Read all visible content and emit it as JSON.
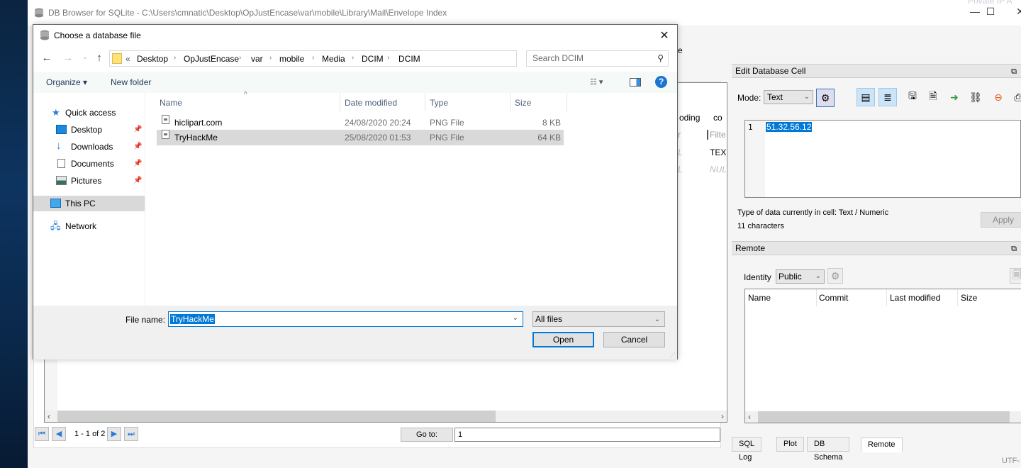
{
  "app": {
    "title": "DB Browser for SQLite - C:\\Users\\cmnatic\\Desktop\\OpJustEncase\\var\\mobile\\Library\\Mail\\Envelope Index",
    "window_controls": {
      "minimize": "—",
      "maximize": "☐",
      "close": "✕"
    },
    "background_snippet": "Private IP A",
    "toolbar_partial_text": "e",
    "table_peek": {
      "header_1": "oding",
      "header_2": "co",
      "filter_1": "r",
      "filter_2": "Filte",
      "row1_c1": "L",
      "row1_c2": "TEX",
      "row2_c1": "L",
      "row2_c2": "NUL"
    },
    "pager": {
      "first": "⏮",
      "prev": "◀",
      "label": "1 - 1 of 2",
      "next": "▶",
      "last": "⏭",
      "goto_label": "Go to:",
      "goto_value": "1"
    },
    "edit_cell": {
      "title": "Edit Database Cell",
      "mode_label": "Mode:",
      "mode_value": "Text",
      "line_number": "1",
      "value": "51.32.56.12",
      "type_text": "Type of data currently in cell: Text / Numeric",
      "chars_text": "11 characters",
      "apply_label": "Apply"
    },
    "remote": {
      "title": "Remote",
      "identity_label": "Identity",
      "identity_value": "Public",
      "columns": [
        "Name",
        "Commit",
        "Last modified",
        "Size"
      ]
    },
    "bottom_tabs": [
      {
        "label": "SQL Log",
        "active": false
      },
      {
        "label": "Plot",
        "active": false
      },
      {
        "label": "DB Schema",
        "active": false
      },
      {
        "label": "Remote",
        "active": true
      }
    ],
    "status_encoding": "UTF-"
  },
  "dialog": {
    "title": "Choose a database file",
    "close": "✕",
    "nav": {
      "back": "←",
      "forward": "→",
      "recent": "⌄",
      "up": "↑"
    },
    "breadcrumb_overflow": "«",
    "breadcrumb": [
      "Desktop",
      "OpJustEncase",
      "var",
      "mobile",
      "Media",
      "DCIM",
      "DCIM"
    ],
    "search_placeholder": "Search DCIM",
    "organize_label": "Organize ▾",
    "new_folder_label": "New folder",
    "nav_pane": [
      {
        "label": "Quick access",
        "icon": "star-icon",
        "pinned": false,
        "selected": false
      },
      {
        "label": "Desktop",
        "icon": "desktop-icon",
        "pinned": true,
        "selected": false
      },
      {
        "label": "Downloads",
        "icon": "download-icon",
        "pinned": true,
        "selected": false
      },
      {
        "label": "Documents",
        "icon": "documents-icon",
        "pinned": true,
        "selected": false
      },
      {
        "label": "Pictures",
        "icon": "pictures-icon",
        "pinned": true,
        "selected": false
      },
      {
        "label": "This PC",
        "icon": "computer-icon",
        "pinned": false,
        "selected": true
      },
      {
        "label": "Network",
        "icon": "network-icon",
        "pinned": false,
        "selected": false
      }
    ],
    "columns": [
      "Name",
      "Date modified",
      "Type",
      "Size"
    ],
    "files": [
      {
        "name": "hiclipart.com",
        "date": "24/08/2020 20:24",
        "type": "PNG File",
        "size": "8 KB",
        "selected": false
      },
      {
        "name": "TryHackMe",
        "date": "25/08/2020 01:53",
        "type": "PNG File",
        "size": "64 KB",
        "selected": true
      }
    ],
    "file_name_label": "File name:",
    "file_name_value": "TryHackMe",
    "filter_value": "All files",
    "open_label": "Open",
    "cancel_label": "Cancel"
  }
}
